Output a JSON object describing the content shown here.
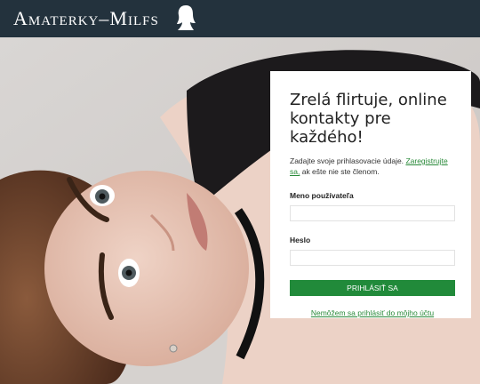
{
  "header": {
    "logo_text": "Amaterky–Milfs",
    "logo_icon": "woman-silhouette-icon"
  },
  "colors": {
    "header_bg": "#23323d",
    "accent": "#218a3a",
    "link": "#2a8a3a"
  },
  "login": {
    "title": "Zrelá flirtuje, online kontakty pre každého!",
    "intro_text": "Zadajte svoje prihlasovacie údaje.",
    "register_link": "Zaregistrujte sa,",
    "intro_tail": "ak ešte nie ste členom.",
    "username_label": "Meno používateľa",
    "username_value": "",
    "password_label": "Heslo",
    "password_value": "",
    "submit_label": "PRIHLÁSIŤ SA",
    "forgot_link": "Nemôžem sa prihlásiť do môjho účtu"
  }
}
